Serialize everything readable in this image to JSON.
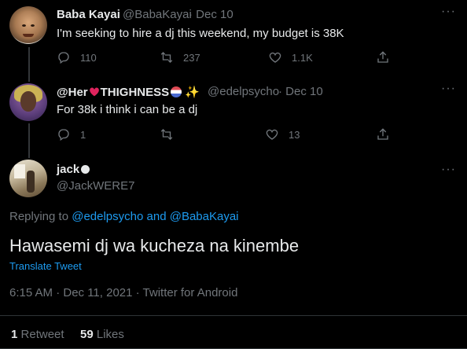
{
  "tweet1": {
    "name": "Baba Kayai",
    "handle": "@BabaKayai",
    "date": "· Dec 10",
    "text": "I'm seeking to hire a dj this weekend, my budget is 38K",
    "replies": "110",
    "retweets": "237",
    "likes": "1.1K"
  },
  "tweet2": {
    "name_prefix": "@Her",
    "name_suffix": "THIGHNESS",
    "handle": "@edelpsycho",
    "date": "· Dec 10",
    "text": "For 38k i think i can be a dj",
    "replies": "1",
    "retweets": "",
    "likes": "13"
  },
  "main_tweet": {
    "name": "jack",
    "handle": "@JackWERE7",
    "replying_prefix": "Replying to",
    "replying_to_1": "@edelpsycho",
    "replying_and": "and",
    "replying_to_2": "@BabaKayai",
    "text": "Hawasemi dj wa kucheza na kinembe",
    "translate": "Translate Tweet",
    "timestamp": "6:15 AM · Dec 11, 2021 · Twitter for Android",
    "retweet_count": "1",
    "retweet_label": "Retweet",
    "like_count": "59",
    "like_label": "Likes"
  },
  "more_glyph": "···",
  "colors": {
    "background": "#000000",
    "text": "#e7e9ea",
    "muted": "#71767b",
    "link": "#1d9bf0",
    "divider": "#2f3336"
  },
  "icons": [
    "reply-icon",
    "retweet-icon",
    "like-icon",
    "share-icon",
    "more-icon",
    "heart-emoji",
    "ball-emoji",
    "sparkles-emoji",
    "verified-dot"
  ]
}
